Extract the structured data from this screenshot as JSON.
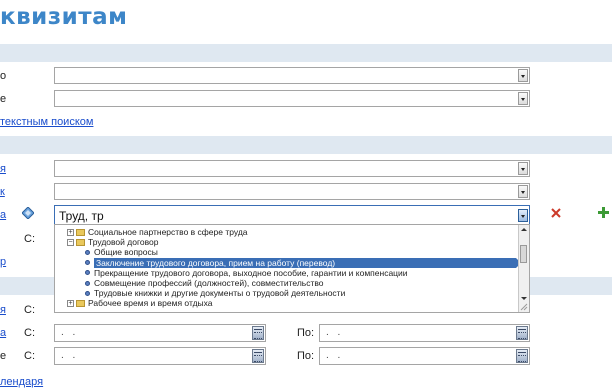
{
  "page": {
    "title": "квизитам"
  },
  "colors": {
    "accent": "#3d86c8",
    "band": "#dfe8f1",
    "link": "#1a4dcc",
    "selection": "#3a6eb5"
  },
  "section1": {
    "row1_label": "о",
    "row2_label": "е",
    "fulltext_link": "текстным поиском"
  },
  "section2": {
    "row1_label": "я",
    "row2_label": "к",
    "row3_label": "а",
    "topic_value": "Труд, тр",
    "row4_label": "С:",
    "row5_label": "р"
  },
  "tree": {
    "items": [
      {
        "label": "Социальное партнерство в сфере труда",
        "kind": "folder",
        "expander": "+"
      },
      {
        "label": "Трудовой договор",
        "kind": "folder",
        "expander": "−"
      },
      {
        "label": "Общие вопросы",
        "kind": "leaf"
      },
      {
        "label": "Заключение трудового договора, прием на работу (перевод)",
        "kind": "leaf",
        "selected": true
      },
      {
        "label": "Прекращение трудового договора, выходное пособие, гарантии и компенсации",
        "kind": "leaf"
      },
      {
        "label": "Совмещение профессий (должностей), совместительство",
        "kind": "leaf"
      },
      {
        "label": "Трудовые книжки и другие документы о трудовой деятельности",
        "kind": "leaf"
      },
      {
        "label": "Рабочее время и время отдыха",
        "kind": "folder",
        "expander": "+"
      }
    ]
  },
  "section3": {
    "row1_label": "я",
    "row1_from": "С:",
    "row2_label": "а",
    "row2_from": "С:",
    "row2_date_from": ". .",
    "row2_to": "По:",
    "row2_date_to": ". .",
    "row3_label": "е",
    "row3_from": "С:",
    "row3_date_from": ". .",
    "row3_to": "По:",
    "row3_date_to": ". .",
    "calendar_link": "лендаря"
  }
}
